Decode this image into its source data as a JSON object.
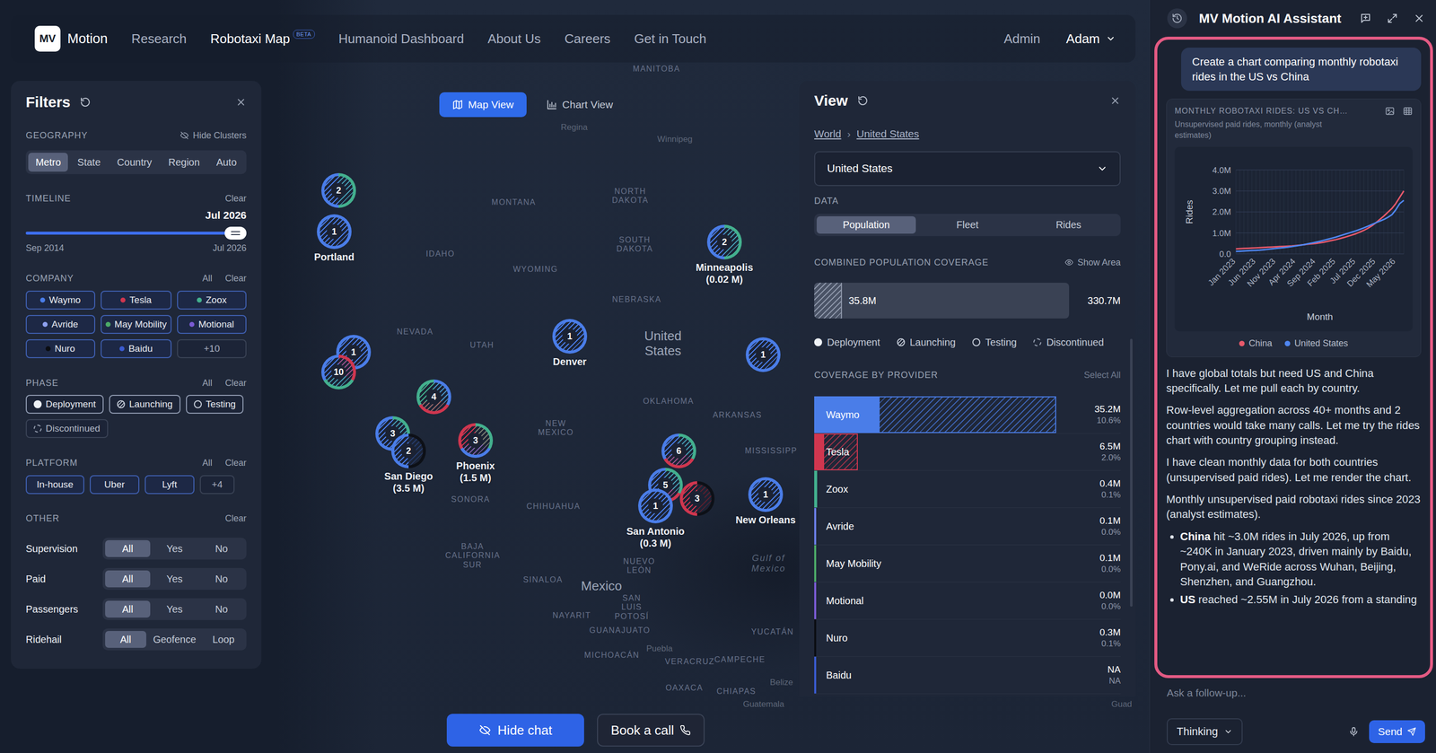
{
  "nav": {
    "logo": "MV",
    "brand": "Motion",
    "links": [
      {
        "label": "Research",
        "selected": false
      },
      {
        "label": "Robotaxi Map",
        "selected": true,
        "badge": "BETA"
      },
      {
        "label": "Humanoid Dashboard",
        "selected": false
      },
      {
        "label": "About Us",
        "selected": false
      },
      {
        "label": "Careers",
        "selected": false
      },
      {
        "label": "Get in Touch",
        "selected": false
      }
    ],
    "admin": "Admin",
    "user": "Adam"
  },
  "view_toggle": [
    {
      "label": "Map View",
      "selected": true,
      "kind": "map"
    },
    {
      "label": "Chart View",
      "selected": false,
      "kind": "chart"
    }
  ],
  "filters": {
    "title": "Filters",
    "geography": {
      "label": "GEOGRAPHY",
      "hide_clusters": "Hide Clusters",
      "tabs": [
        {
          "label": "Metro",
          "selected": true
        },
        {
          "label": "State",
          "selected": false
        },
        {
          "label": "Country",
          "selected": false
        },
        {
          "label": "Region",
          "selected": false
        },
        {
          "label": "Auto",
          "selected": false
        }
      ]
    },
    "timeline": {
      "label": "TIMELINE",
      "clear": "Clear",
      "value": "Jul 2026",
      "level": 1.0,
      "start": "Sep 2014",
      "end": "Jul 2026"
    },
    "company": {
      "label": "COMPANY",
      "all": "All",
      "clear": "Clear",
      "chips": [
        {
          "label": "Waymo",
          "color": "#4a7de8",
          "selected": true
        },
        {
          "label": "Tesla",
          "color": "#d0364f",
          "selected": true
        },
        {
          "label": "Zoox",
          "color": "#43b08e",
          "selected": true
        },
        {
          "label": "Avride",
          "color": "#8fa2f0",
          "selected": true
        },
        {
          "label": "May Mobility",
          "color": "#4caa68",
          "selected": true
        },
        {
          "label": "Motional",
          "color": "#7a5bd4",
          "selected": true
        },
        {
          "label": "Nuro",
          "color": "#0b0d12",
          "selected": true
        },
        {
          "label": "Baidu",
          "color": "#3a5bd0",
          "selected": true
        }
      ],
      "more": "+10"
    },
    "phase": {
      "label": "PHASE",
      "all": "All",
      "clear": "Clear",
      "chips": [
        {
          "label": "Deployment",
          "kind": "deployment",
          "selected": true
        },
        {
          "label": "Launching",
          "kind": "launching",
          "selected": true
        },
        {
          "label": "Testing",
          "kind": "testing",
          "selected": true
        },
        {
          "label": "Discontinued",
          "kind": "discontinued",
          "selected": false
        }
      ]
    },
    "platform": {
      "label": "PLATFORM",
      "all": "All",
      "clear": "Clear",
      "chips": [
        {
          "label": "In-house",
          "selected": true
        },
        {
          "label": "Uber",
          "selected": true
        },
        {
          "label": "Lyft",
          "selected": true
        }
      ],
      "more": "+4"
    },
    "other": {
      "label": "OTHER",
      "clear": "Clear",
      "rows": [
        {
          "label": "Supervision",
          "options": [
            {
              "label": "All",
              "selected": true
            },
            {
              "label": "Yes",
              "selected": false
            },
            {
              "label": "No",
              "selected": false
            }
          ]
        },
        {
          "label": "Paid",
          "options": [
            {
              "label": "All",
              "selected": true
            },
            {
              "label": "Yes",
              "selected": false
            },
            {
              "label": "No",
              "selected": false
            }
          ]
        },
        {
          "label": "Passengers",
          "options": [
            {
              "label": "All",
              "selected": true
            },
            {
              "label": "Yes",
              "selected": false
            },
            {
              "label": "No",
              "selected": false
            }
          ]
        },
        {
          "label": "Ridehail",
          "options": [
            {
              "label": "All",
              "selected": true
            },
            {
              "label": "Geofence",
              "selected": false
            },
            {
              "label": "Loop",
              "selected": false
            }
          ]
        }
      ]
    }
  },
  "map": {
    "labels": [
      {
        "text": "MANITOBA",
        "kind": "state"
      },
      {
        "text": "Regina",
        "kind": "city"
      },
      {
        "text": "Winnipeg",
        "kind": "city"
      },
      {
        "text": "MONTANA",
        "kind": "state"
      },
      {
        "text": "NORTH DAKOTA",
        "kind": "state"
      },
      {
        "text": "SOUTH DAKOTA",
        "kind": "state"
      },
      {
        "text": "IDAHO",
        "kind": "state"
      },
      {
        "text": "WYOMING",
        "kind": "state"
      },
      {
        "text": "NEBRASKA",
        "kind": "state"
      },
      {
        "text": "NEVADA",
        "kind": "state"
      },
      {
        "text": "UTAH",
        "kind": "state"
      },
      {
        "text": "United States",
        "kind": "country"
      },
      {
        "text": "OKLAHOMA",
        "kind": "state"
      },
      {
        "text": "ARKANSAS",
        "kind": "state"
      },
      {
        "text": "MISSISSIPP",
        "kind": "state"
      },
      {
        "text": "NEW MEXICO",
        "kind": "state"
      },
      {
        "text": "SONORA",
        "kind": "state"
      },
      {
        "text": "CHIHUAHUA",
        "kind": "state"
      },
      {
        "text": "BAJA CALIFORNIA SUR",
        "kind": "state"
      },
      {
        "text": "SINALOA",
        "kind": "state"
      },
      {
        "text": "Mexico",
        "kind": "country"
      },
      {
        "text": "NUEVO LEÓN",
        "kind": "state"
      },
      {
        "text": "SAN LUIS POTOSÍ",
        "kind": "state"
      },
      {
        "text": "NAYARIT",
        "kind": "state"
      },
      {
        "text": "GUANAJUATO",
        "kind": "state"
      },
      {
        "text": "MICHOACÁN",
        "kind": "state"
      },
      {
        "text": "Puebla",
        "kind": "city"
      },
      {
        "text": "VERACRUZ",
        "kind": "state"
      },
      {
        "text": "CAMPECHE",
        "kind": "state"
      },
      {
        "text": "YUCATÁN",
        "kind": "state"
      },
      {
        "text": "OAXACA",
        "kind": "state"
      },
      {
        "text": "CHIAPAS",
        "kind": "state"
      },
      {
        "text": "Belize",
        "kind": "city"
      },
      {
        "text": "Guatemala",
        "kind": "city"
      },
      {
        "text": "Gulf of Mexico",
        "kind": "water"
      },
      {
        "text": "Guad",
        "kind": "city"
      }
    ],
    "markers": [
      {
        "count": "2",
        "colors": [
          "#43b08e",
          "#4a7de8"
        ]
      },
      {
        "count": "1",
        "colors": [
          "#4a7de8"
        ],
        "label": "Portland"
      },
      {
        "count": "1",
        "colors": [
          "#4a7de8"
        ]
      },
      {
        "count": "10",
        "colors": [
          "#d0364f",
          "#43b08e",
          "#4a7de8"
        ]
      },
      {
        "count": "4",
        "colors": [
          "#4a7de8",
          "#d0364f",
          "#43b08e"
        ]
      },
      {
        "count": "3",
        "colors": [
          "#43b08e",
          "#4a7de8"
        ]
      },
      {
        "count": "2",
        "colors": [
          "#0d1017",
          "#4a7de8"
        ],
        "label": "San Diego",
        "sub": "(3.5 M)"
      },
      {
        "count": "3",
        "colors": [
          "#43b08e",
          "#4a7de8",
          "#d0364f"
        ],
        "label": "Phoenix",
        "sub": "(1.5 M)"
      },
      {
        "count": "1",
        "colors": [
          "#4a7de8"
        ],
        "label": "Denver"
      },
      {
        "count": "2",
        "colors": [
          "#43b08e",
          "#4a7de8"
        ],
        "label": "Minneapolis",
        "sub": "(0.02 M)"
      },
      {
        "count": "1",
        "colors": [
          "#4a7de8"
        ]
      },
      {
        "count": "6",
        "colors": [
          "#43b08e",
          "#d0364f",
          "#4a7de8"
        ]
      },
      {
        "count": "5",
        "colors": [
          "#43b08e",
          "#d0364f",
          "#4a7de8"
        ]
      },
      {
        "count": "1",
        "colors": [
          "#4a7de8"
        ],
        "label": "San Antonio",
        "sub": "(0.3 M)"
      },
      {
        "count": "3",
        "colors": [
          "#0d1017",
          "#d0364f"
        ]
      },
      {
        "count": "1",
        "colors": [
          "#4a7de8"
        ],
        "label": "New Orleans"
      }
    ]
  },
  "view": {
    "title": "View",
    "breadcrumb": [
      "World",
      "United States"
    ],
    "breadcrumb_sep": "›",
    "select": "United States",
    "data_label": "DATA",
    "tabs": [
      {
        "label": "Population",
        "selected": true
      },
      {
        "label": "Fleet",
        "selected": false
      },
      {
        "label": "Rides",
        "selected": false
      }
    ],
    "coverage": {
      "label": "COMBINED POPULATION COVERAGE",
      "show_area": "Show Area",
      "value": "35.8M",
      "total": "330.7M",
      "level": 0.108
    },
    "legend": [
      {
        "label": "Deployment",
        "kind": "deployment"
      },
      {
        "label": "Launching",
        "kind": "launching"
      },
      {
        "label": "Testing",
        "kind": "testing"
      },
      {
        "label": "Discontinued",
        "kind": "discontinued"
      }
    ],
    "providers_label": "COVERAGE BY PROVIDER",
    "select_all": "Select All",
    "providers": [
      {
        "name": "Waymo",
        "value": "35.2M",
        "share": "10.6%",
        "color": "#4a7de8",
        "level": 0.27,
        "launch_level": 1.0
      },
      {
        "name": "Tesla",
        "value": "6.5M",
        "share": "2.0%",
        "color": "#d0364f",
        "level": 0.04,
        "launch_level": 0.18
      },
      {
        "name": "Zoox",
        "value": "0.4M",
        "share": "0.1%",
        "color": "#43b08e",
        "level": 0.01,
        "launch_level": 0.012
      },
      {
        "name": "Avride",
        "value": "0.1M",
        "share": "0.0%",
        "color": "#6a7ee6",
        "level": 0.005,
        "launch_level": 0.006
      },
      {
        "name": "May Mobility",
        "value": "0.1M",
        "share": "0.0%",
        "color": "#4caa68",
        "level": 0.005,
        "launch_level": 0.006
      },
      {
        "name": "Motional",
        "value": "0.0M",
        "share": "0.0%",
        "color": "#7a5bd4",
        "level": 0.004,
        "launch_level": 0.004
      },
      {
        "name": "Nuro",
        "value": "0.3M",
        "share": "0.1%",
        "color": "#0b0d12",
        "level": 0.006,
        "launch_level": 0.008
      },
      {
        "name": "Baidu",
        "value": "NA",
        "share": "NA",
        "color": "#3a5bd0",
        "level": 0.0,
        "launch_level": 0.0
      }
    ]
  },
  "bottom": {
    "hide_chat": "Hide chat",
    "book_call": "Book a call"
  },
  "chat": {
    "title": "MV Motion AI Assistant",
    "user_message": "Create a chart comparing monthly robotaxi rides in the US vs China",
    "chart": {
      "title": "MONTHLY ROBOTAXI RIDES: US VS CH…",
      "subtitle": "Unsupervised paid rides, monthly (analyst estimates)",
      "y_label": "Rides",
      "x_label": "Month",
      "y_ticks": [
        "4.0M",
        "3.0M",
        "2.0M",
        "1.0M",
        "0.0"
      ],
      "x_ticks": [
        "Jan 2023",
        "Jun 2023",
        "Nov 2023",
        "Apr 2024",
        "Sep 2024",
        "Feb 2025",
        "Jul 2025",
        "Dec 2025",
        "May 2026"
      ],
      "series": [
        {
          "name": "China",
          "color": "#e8596b",
          "values": [
            0.24,
            0.25,
            0.26,
            0.27,
            0.28,
            0.29,
            0.3,
            0.31,
            0.32,
            0.33,
            0.34,
            0.35,
            0.36,
            0.37,
            0.38,
            0.4,
            0.42,
            0.44,
            0.46,
            0.48,
            0.5,
            0.53,
            0.56,
            0.6,
            0.64,
            0.68,
            0.73,
            0.78,
            0.84,
            0.9,
            0.96,
            1.04,
            1.12,
            1.22,
            1.34,
            1.48,
            1.64,
            1.8,
            1.98,
            2.16,
            2.4,
            2.7,
            3.0
          ]
        },
        {
          "name": "United States",
          "color": "#4f86f0",
          "values": [
            0.12,
            0.13,
            0.14,
            0.15,
            0.16,
            0.17,
            0.18,
            0.2,
            0.22,
            0.24,
            0.26,
            0.28,
            0.3,
            0.32,
            0.35,
            0.38,
            0.41,
            0.44,
            0.48,
            0.52,
            0.56,
            0.6,
            0.65,
            0.7,
            0.75,
            0.8,
            0.86,
            0.92,
            0.98,
            1.04,
            1.1,
            1.17,
            1.24,
            1.32,
            1.4,
            1.48,
            1.56,
            1.64,
            1.74,
            1.86,
            2.1,
            2.4,
            2.55
          ]
        }
      ]
    },
    "paragraphs": [
      "I have global totals but need US and China specifically. Let me pull each by country.",
      "Row-level aggregation across 40+ months and 2 countries would take many calls. Let me try the rides chart with country grouping instead.",
      "I have clean monthly data for both countries (unsupervised paid rides). Let me render the chart.",
      "Monthly unsupervised paid robotaxi rides since 2023 (analyst estimates)."
    ],
    "bullets": [
      {
        "bold": "China",
        "text": " hit ~3.0M rides in July 2026, up from ~240K in January 2023, driven mainly by Baidu, Pony.ai, and WeRide across Wuhan, Beijing, Shenzhen, and Guangzhou."
      },
      {
        "bold": "US",
        "text": " reached ~2.55M in July 2026 from a standing"
      }
    ],
    "input_placeholder": "Ask a follow-up...",
    "mode": "Thinking",
    "send": "Send"
  }
}
